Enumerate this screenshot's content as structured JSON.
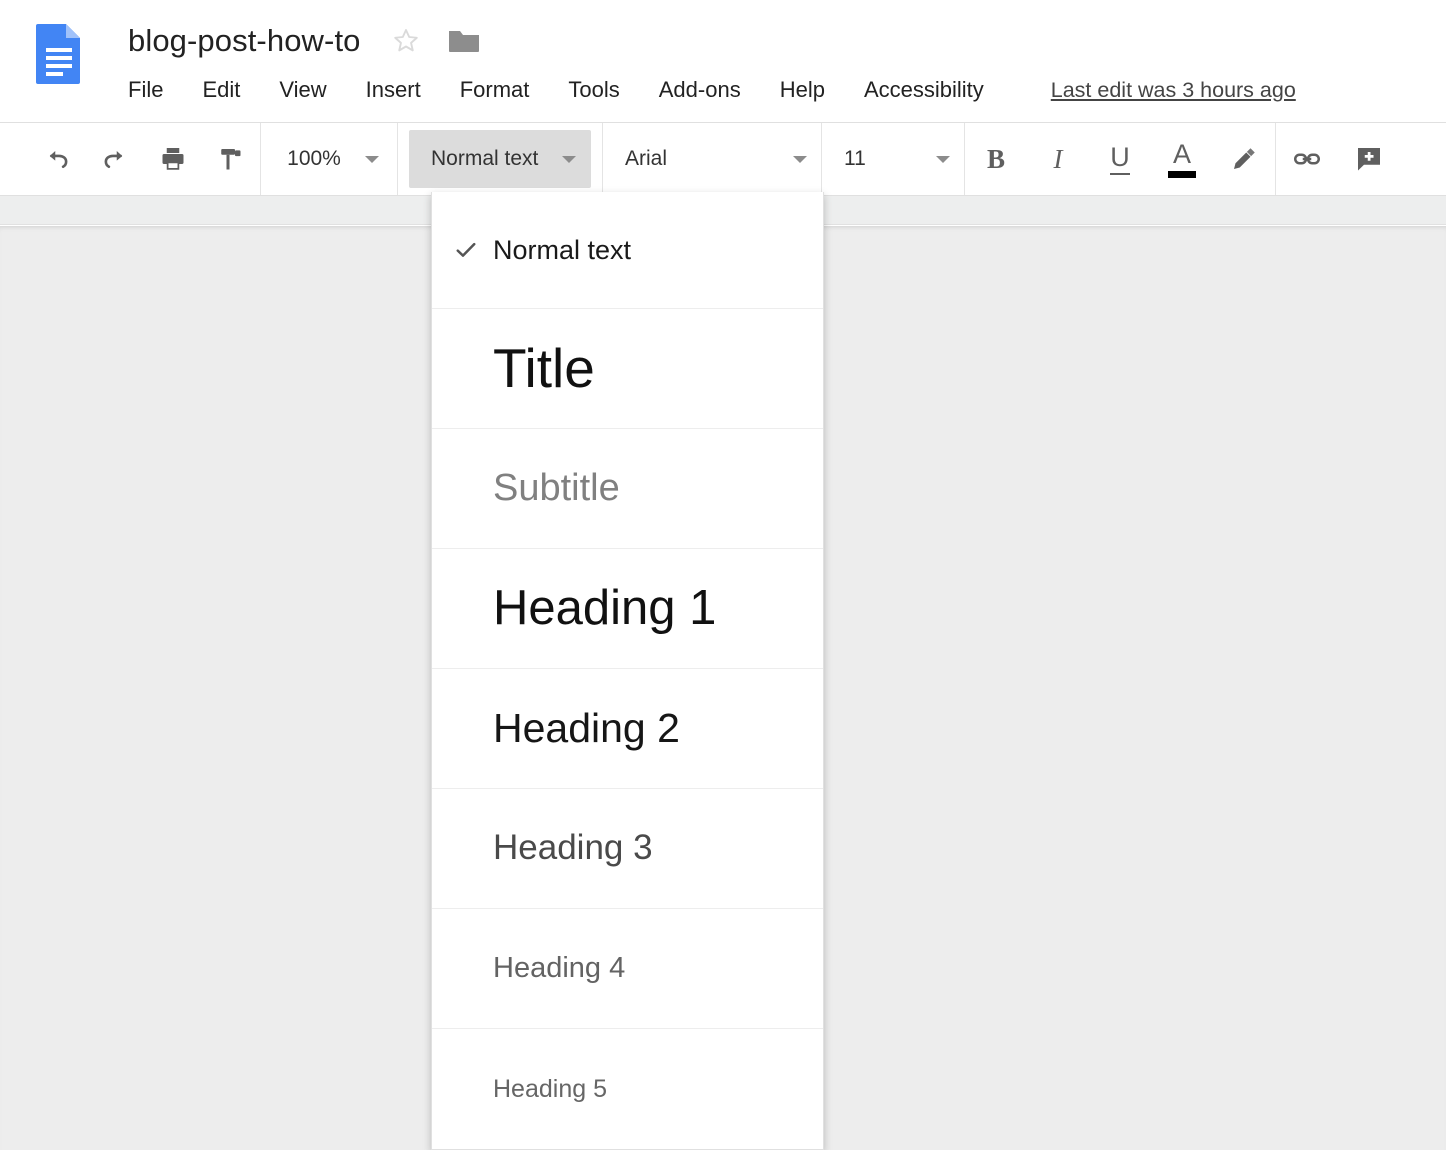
{
  "app": {
    "name": "Google Docs",
    "doc_icon": "google-docs-icon"
  },
  "header": {
    "title": "blog-post-how-to",
    "star_icon": "star-outline-icon",
    "folder_icon": "move-to-folder-icon",
    "menu": [
      {
        "label": "File"
      },
      {
        "label": "Edit"
      },
      {
        "label": "View"
      },
      {
        "label": "Insert"
      },
      {
        "label": "Format"
      },
      {
        "label": "Tools"
      },
      {
        "label": "Add-ons"
      },
      {
        "label": "Help"
      },
      {
        "label": "Accessibility"
      }
    ],
    "last_edit": "Last edit was 3 hours ago"
  },
  "toolbar": {
    "undo_icon": "undo-icon",
    "redo_icon": "redo-icon",
    "print_icon": "print-icon",
    "paint_format_icon": "paint-format-icon",
    "zoom_value": "100%",
    "style_value": "Normal text",
    "font_value": "Arial",
    "font_size_value": "11",
    "bold_label": "B",
    "italic_label": "I",
    "underline_label": "U",
    "text_color_label": "A",
    "text_color_swatch": "#000000",
    "highlight_icon": "highlight-pen-icon",
    "link_icon": "insert-link-icon",
    "comment_icon": "add-comment-icon"
  },
  "styles_menu": {
    "open": true,
    "items": [
      {
        "label": "Normal text",
        "checked": true,
        "class": "si-normal"
      },
      {
        "label": "Title",
        "checked": false,
        "class": "si-title"
      },
      {
        "label": "Subtitle",
        "checked": false,
        "class": "si-subtitle"
      },
      {
        "label": "Heading 1",
        "checked": false,
        "class": "si-h1"
      },
      {
        "label": "Heading 2",
        "checked": false,
        "class": "si-h2"
      },
      {
        "label": "Heading 3",
        "checked": false,
        "class": "si-h3"
      },
      {
        "label": "Heading 4",
        "checked": false,
        "class": "si-h4"
      },
      {
        "label": "Heading 5",
        "checked": false,
        "class": "si-h5"
      }
    ],
    "checkmark_icon": "checkmark-icon"
  },
  "colors": {
    "docs_blue": "#4285f4",
    "canvas_gray": "#ededed",
    "ruler_gray": "#edeeee",
    "active_dropdown": "#dcdcdc"
  }
}
